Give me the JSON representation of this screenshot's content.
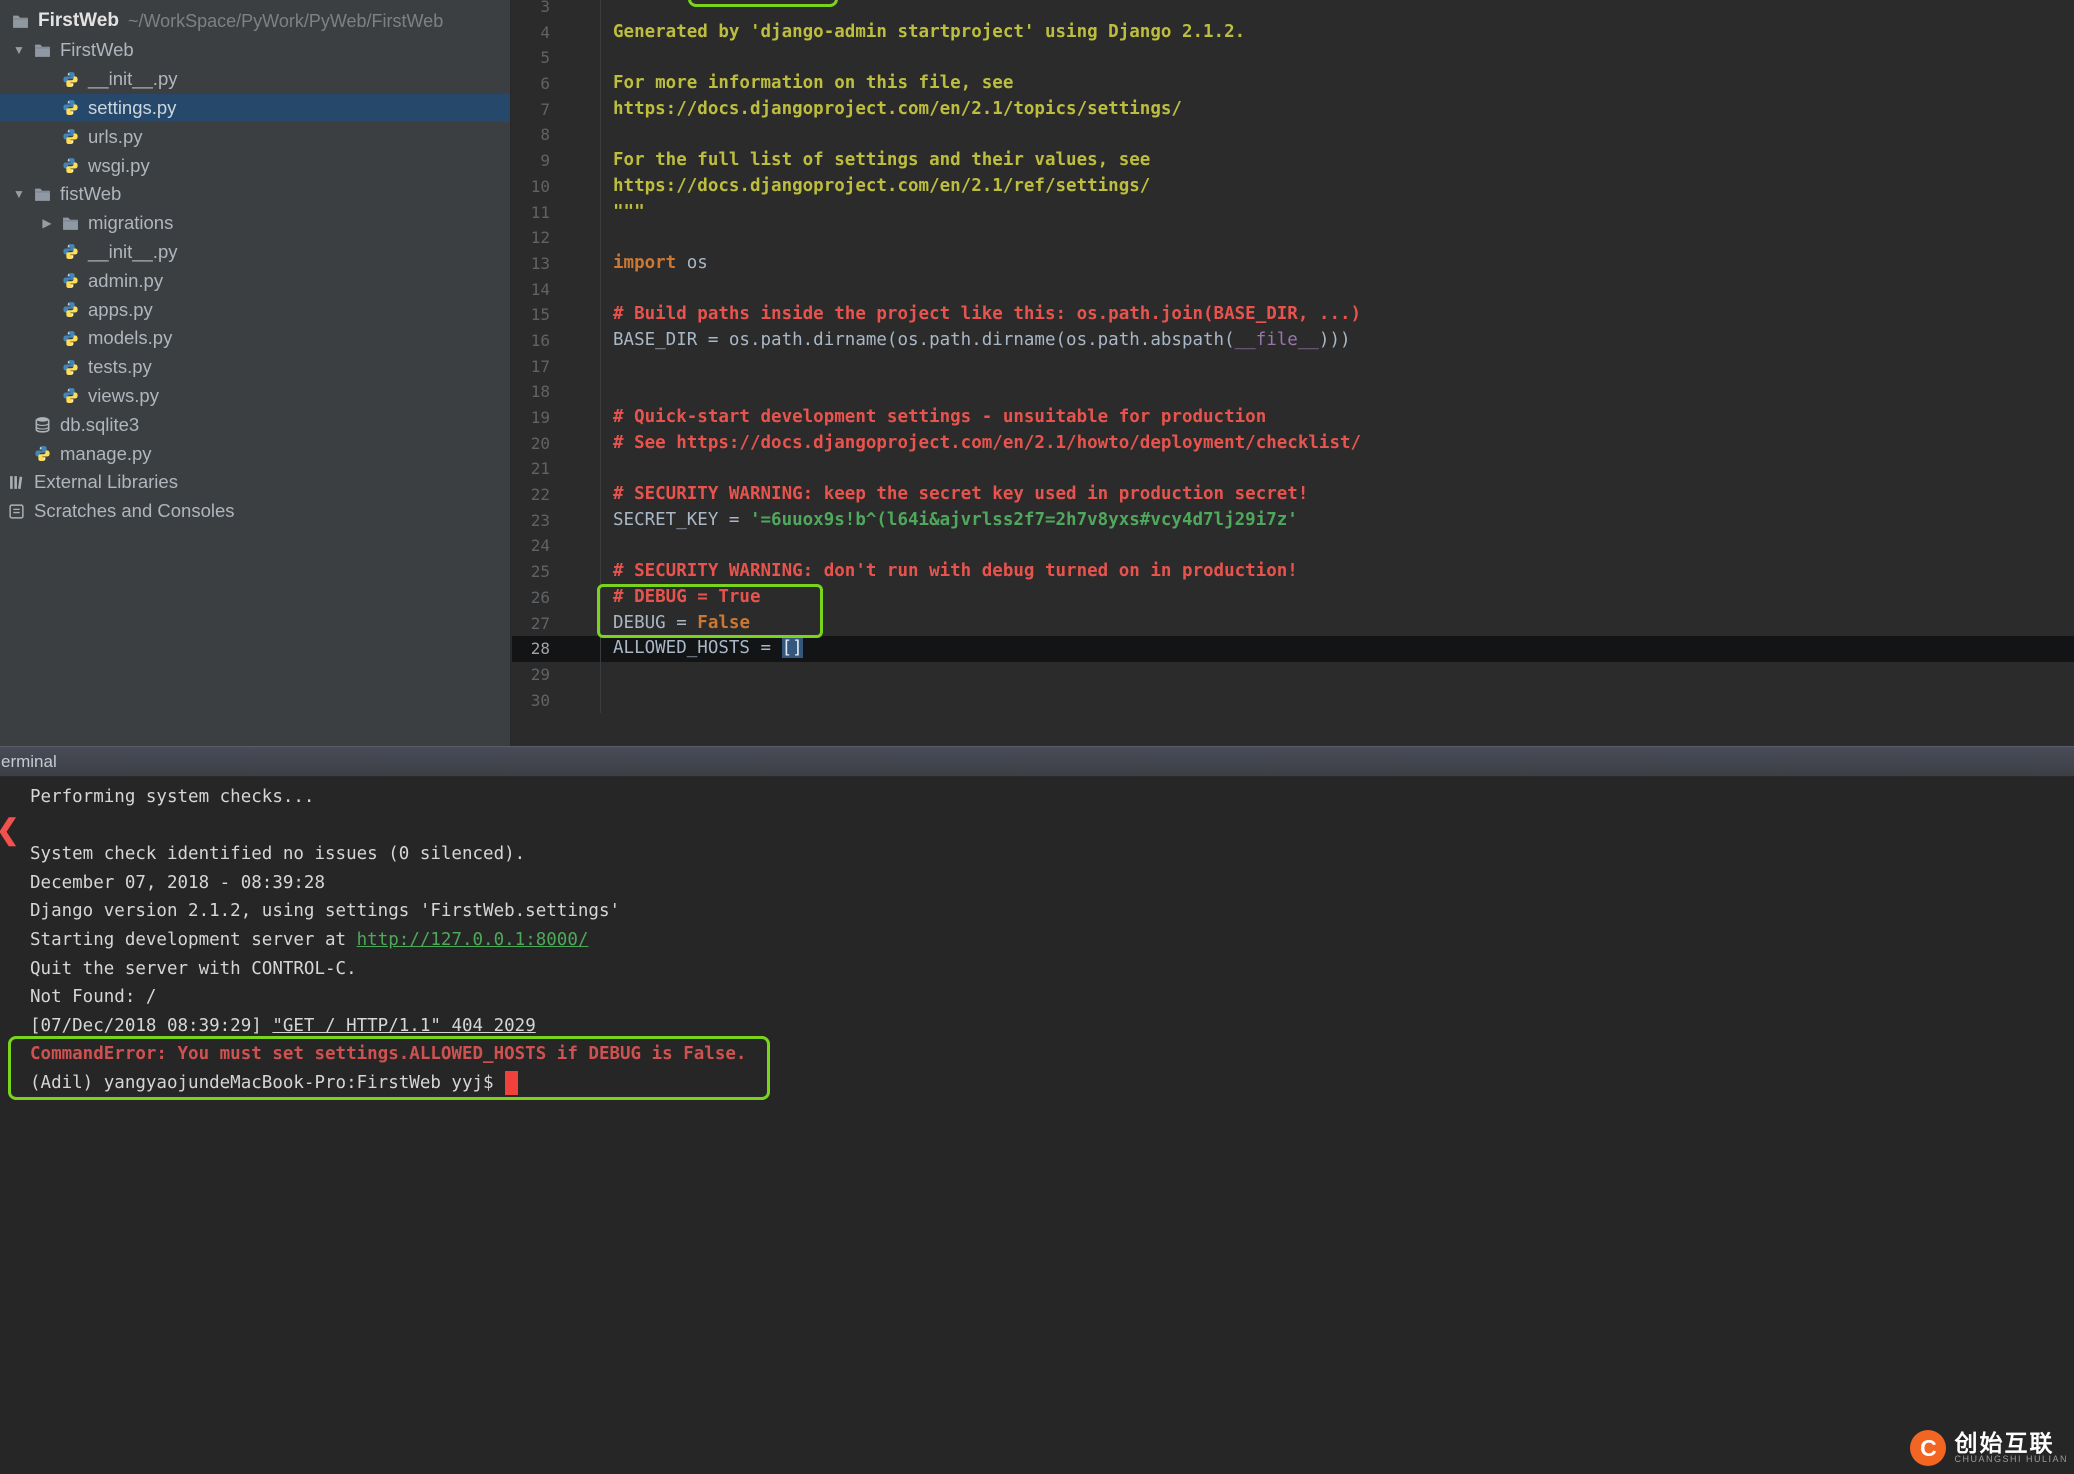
{
  "colors": {
    "annotation_green": "#7ad41c",
    "selection_blue": "#26486b",
    "cursor_red": "#f0413c",
    "panel_bg": "#3c3f41",
    "editor_bg": "#2b2b2b"
  },
  "project_panel": {
    "root": {
      "name": "FirstWeb",
      "path": "~/WorkSpace/PyWork/PyWeb/FirstWeb"
    },
    "items": [
      {
        "label": "FirstWeb",
        "icon": "folder",
        "depth": 1,
        "arrow": "down"
      },
      {
        "label": "__init__.py",
        "icon": "python",
        "depth": 2
      },
      {
        "label": "settings.py",
        "icon": "python",
        "depth": 2,
        "selected": true
      },
      {
        "label": "urls.py",
        "icon": "python",
        "depth": 2
      },
      {
        "label": "wsgi.py",
        "icon": "python",
        "depth": 2
      },
      {
        "label": "fistWeb",
        "icon": "folder",
        "depth": 1,
        "arrow": "down"
      },
      {
        "label": "migrations",
        "icon": "folder",
        "depth": 2,
        "arrow": "right"
      },
      {
        "label": "__init__.py",
        "icon": "python",
        "depth": 2
      },
      {
        "label": "admin.py",
        "icon": "python",
        "depth": 2
      },
      {
        "label": "apps.py",
        "icon": "python",
        "depth": 2
      },
      {
        "label": "models.py",
        "icon": "python",
        "depth": 2
      },
      {
        "label": "tests.py",
        "icon": "python",
        "depth": 2
      },
      {
        "label": "views.py",
        "icon": "python",
        "depth": 2
      },
      {
        "label": "db.sqlite3",
        "icon": "database",
        "depth": 1
      },
      {
        "label": "manage.py",
        "icon": "python",
        "depth": 1
      },
      {
        "label": "External Libraries",
        "icon": "libraries",
        "depth": 0
      },
      {
        "label": "Scratches and Consoles",
        "icon": "scratches",
        "depth": 0
      }
    ]
  },
  "editor": {
    "file": "settings.py",
    "lines": [
      {
        "n": 3,
        "segs": []
      },
      {
        "n": 4,
        "segs": [
          {
            "c": "doc",
            "t": "Generated by 'django-admin startproject' using Django 2.1.2."
          }
        ]
      },
      {
        "n": 5,
        "segs": []
      },
      {
        "n": 6,
        "segs": [
          {
            "c": "doc",
            "t": "For more information on this file, see"
          }
        ]
      },
      {
        "n": 7,
        "segs": [
          {
            "c": "doc",
            "t": "https://docs.djangoproject.com/en/2.1/topics/settings/"
          }
        ]
      },
      {
        "n": 8,
        "segs": []
      },
      {
        "n": 9,
        "segs": [
          {
            "c": "doc",
            "t": "For the full list of settings and their values, see"
          }
        ]
      },
      {
        "n": 10,
        "segs": [
          {
            "c": "doc",
            "t": "https://docs.djangoproject.com/en/2.1/ref/settings/"
          }
        ]
      },
      {
        "n": 11,
        "segs": [
          {
            "c": "doc",
            "t": "\"\"\""
          }
        ]
      },
      {
        "n": 12,
        "segs": []
      },
      {
        "n": 13,
        "segs": [
          {
            "c": "kw",
            "t": "import"
          },
          {
            "c": "def",
            "t": " os"
          }
        ]
      },
      {
        "n": 14,
        "segs": []
      },
      {
        "n": 15,
        "segs": [
          {
            "c": "cmt",
            "t": "# Build paths inside the project like this: os.path.join(BASE_DIR, ...)"
          }
        ]
      },
      {
        "n": 16,
        "segs": [
          {
            "c": "def",
            "t": "BASE_DIR = os.path.dirname(os.path.dirname(os.path.abspath("
          },
          {
            "c": "magic",
            "t": "__file__"
          },
          {
            "c": "def",
            "t": ")))"
          }
        ]
      },
      {
        "n": 17,
        "segs": []
      },
      {
        "n": 18,
        "segs": []
      },
      {
        "n": 19,
        "segs": [
          {
            "c": "cmt",
            "t": "# Quick-start development settings - unsuitable for production"
          }
        ]
      },
      {
        "n": 20,
        "segs": [
          {
            "c": "cmt",
            "t": "# See https://docs.djangoproject.com/en/2.1/howto/deployment/checklist/"
          }
        ]
      },
      {
        "n": 21,
        "segs": []
      },
      {
        "n": 22,
        "segs": [
          {
            "c": "cmt",
            "t": "# SECURITY WARNING: keep the secret key used in production secret!"
          }
        ]
      },
      {
        "n": 23,
        "segs": [
          {
            "c": "def",
            "t": "SECRET_KEY = "
          },
          {
            "c": "str",
            "t": "'=6uuox9s!b^(l64i&ajvrlss2f7=2h7v8yxs#vcy4d7lj29i7z'"
          }
        ]
      },
      {
        "n": 24,
        "segs": []
      },
      {
        "n": 25,
        "segs": [
          {
            "c": "cmt",
            "t": "# SECURITY WARNING: don't run with debug turned on in production!"
          }
        ]
      },
      {
        "n": 26,
        "segs": [
          {
            "c": "cmt",
            "t": "# DEBUG = True"
          }
        ]
      },
      {
        "n": 27,
        "segs": [
          {
            "c": "def",
            "t": "DEBUG = "
          },
          {
            "c": "kw",
            "t": "False"
          }
        ]
      },
      {
        "n": 28,
        "current": true,
        "segs": [
          {
            "c": "def",
            "t": "ALLOWED_HOSTS = "
          },
          {
            "c": "brk",
            "t": "[]"
          }
        ]
      },
      {
        "n": 29,
        "segs": []
      },
      {
        "n": 30,
        "segs": []
      }
    ]
  },
  "terminal": {
    "title": "erminal",
    "lines": [
      {
        "segs": [
          {
            "c": "plain",
            "t": "Performing system checks..."
          }
        ]
      },
      {
        "segs": []
      },
      {
        "segs": [
          {
            "c": "plain",
            "t": "System check identified no issues (0 silenced)."
          }
        ]
      },
      {
        "segs": [
          {
            "c": "plain",
            "t": "December 07, 2018 - 08:39:28"
          }
        ]
      },
      {
        "segs": [
          {
            "c": "plain",
            "t": "Django version 2.1.2, using settings 'FirstWeb.settings'"
          }
        ]
      },
      {
        "segs": [
          {
            "c": "plain",
            "t": "Starting development server at "
          },
          {
            "c": "link",
            "t": "http://127.0.0.1:8000/"
          }
        ]
      },
      {
        "segs": [
          {
            "c": "plain",
            "t": "Quit the server with CONTROL-C."
          }
        ]
      },
      {
        "segs": [
          {
            "c": "plain",
            "t": "Not Found: /"
          }
        ]
      },
      {
        "segs": [
          {
            "c": "plain",
            "t": "[07/Dec/2018 08:39:29] "
          },
          {
            "c": "under",
            "t": "\"GET / HTTP/1.1\" 404 2029"
          }
        ]
      },
      {
        "segs": [
          {
            "c": "err",
            "t": "CommandError: You must set settings.ALLOWED_HOSTS if DEBUG is False."
          }
        ]
      },
      {
        "segs": [
          {
            "c": "plain",
            "t": "(Adil) yangyaojundeMacBook-Pro:FirstWeb yyj$ "
          },
          {
            "c": "cursor",
            "t": ""
          }
        ]
      }
    ]
  },
  "watermark": {
    "logo_letter": "C",
    "title": "创始互联",
    "subtitle": "CHUANGSHI HULIAN"
  }
}
